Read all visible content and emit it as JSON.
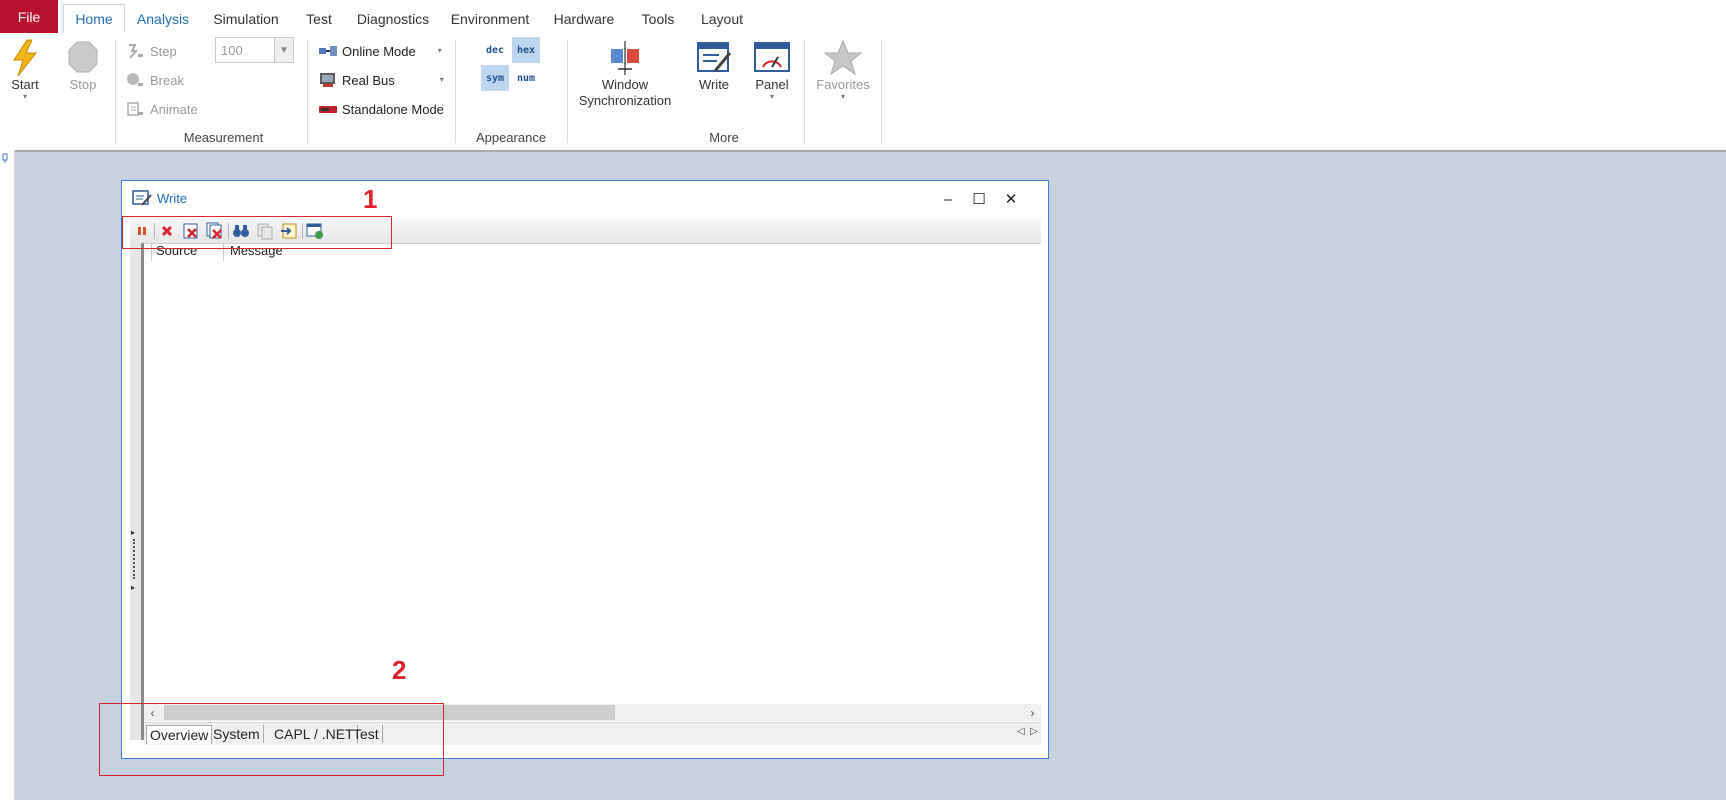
{
  "tabs": {
    "file": "File",
    "items": [
      "Home",
      "Analysis",
      "Simulation",
      "Test",
      "Diagnostics",
      "Environment",
      "Hardware",
      "Tools",
      "Layout"
    ],
    "active": "Home"
  },
  "ribbon": {
    "start": "Start",
    "stop": "Stop",
    "step": "Step",
    "break": "Break",
    "animate": "Animate",
    "step_value": "100",
    "online_mode": "Online Mode",
    "real_bus": "Real Bus",
    "standalone_mode": "Standalone Mode",
    "group_measurement": "Measurement",
    "fmt_dec": "dec",
    "fmt_hex": "hex",
    "fmt_sym": "sym",
    "fmt_num": "num",
    "group_appearance": "Appearance",
    "window_sync_line1": "Window",
    "window_sync_line2": "Synchronization",
    "write": "Write",
    "panel": "Panel",
    "favorites": "Favorites",
    "group_more": "More"
  },
  "write_window": {
    "title": "Write",
    "col_source": "Source",
    "col_message": "Message",
    "bottom_tabs": [
      "Overview",
      "System",
      "CAPL / .NET",
      "Test"
    ],
    "active_tab": "Overview"
  },
  "annotations": {
    "label1": "1",
    "label2": "2",
    "color": "#d9232d"
  },
  "colors": {
    "file_tab": "#b8102d",
    "accent": "#1f6fb8",
    "workspace": "#c8d1e0"
  }
}
